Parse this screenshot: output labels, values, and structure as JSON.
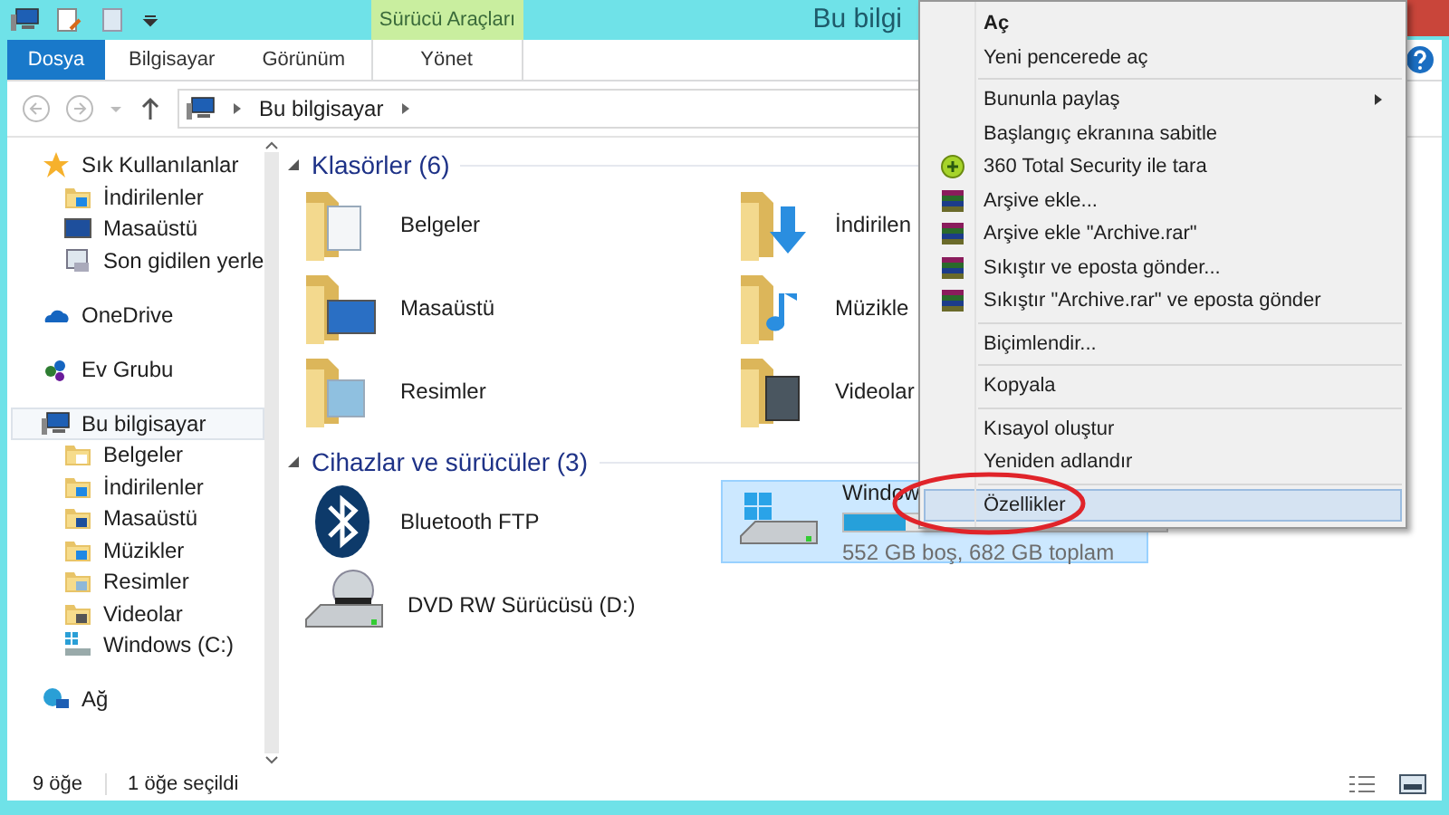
{
  "title_bar": {
    "title": "Bu bilgi",
    "context_tab": "Sürücü Araçları"
  },
  "ribbon_tabs": [
    {
      "label": "Dosya",
      "kind": "file"
    },
    {
      "label": "Bilgisayar",
      "kind": "tab"
    },
    {
      "label": "Görünüm",
      "kind": "tab"
    },
    {
      "label": "Yönet",
      "kind": "context"
    }
  ],
  "address_bar": {
    "path": [
      "Bu bilgisayar"
    ]
  },
  "navigation": [
    {
      "label": "Sık Kullanılanlar",
      "selected": false,
      "children": [
        {
          "label": "İndirilenler"
        },
        {
          "label": "Masaüstü"
        },
        {
          "label": "Son gidilen yerle"
        }
      ]
    },
    {
      "label": "OneDrive",
      "selected": false
    },
    {
      "label": "Ev Grubu",
      "selected": false
    },
    {
      "label": "Bu bilgisayar",
      "selected": true,
      "children": [
        {
          "label": "Belgeler"
        },
        {
          "label": "İndirilenler"
        },
        {
          "label": "Masaüstü"
        },
        {
          "label": "Müzikler"
        },
        {
          "label": "Resimler"
        },
        {
          "label": "Videolar"
        },
        {
          "label": "Windows (C:)"
        }
      ]
    },
    {
      "label": "Ağ",
      "selected": false
    }
  ],
  "sections": [
    {
      "title": "Klasörler (6)",
      "expanded": true,
      "items": [
        {
          "kind": "folder",
          "label": "Belgeler",
          "selected": false
        },
        {
          "kind": "folder",
          "label": "İndirilen",
          "selected": false
        },
        {
          "kind": "folder",
          "label": "Masaüstü",
          "selected": false
        },
        {
          "kind": "folder",
          "label": "Müzikle",
          "selected": false
        },
        {
          "kind": "folder",
          "label": "Resimler",
          "selected": false
        },
        {
          "kind": "folder",
          "label": "Videolar",
          "selected": false
        }
      ]
    },
    {
      "title": "Cihazlar ve sürücüler (3)",
      "expanded": true,
      "items": [
        {
          "kind": "device",
          "label": "Bluetooth FTP",
          "selected": false
        },
        {
          "kind": "drive",
          "label": "Window",
          "selected": true,
          "level": 0.19,
          "detail": "552 GB boş, 682 GB toplam"
        },
        {
          "kind": "device",
          "label": "DVD RW Sürücüsü (D:)",
          "selected": false
        }
      ]
    }
  ],
  "context_menu": {
    "groups": [
      [
        {
          "label": "Aç",
          "default": true,
          "submenu": false,
          "selected": false
        },
        {
          "label": "Yeni pencerede aç",
          "default": false,
          "submenu": false,
          "selected": false
        }
      ],
      [
        {
          "label": "Bununla paylaş",
          "default": false,
          "submenu": true,
          "selected": false
        },
        {
          "label": "Başlangıç ekranına sabitle",
          "default": false,
          "submenu": false,
          "selected": false
        },
        {
          "label": "360 Total Security ile tara",
          "default": false,
          "submenu": false,
          "selected": false
        },
        {
          "label": "Arşive ekle...",
          "default": false,
          "submenu": false,
          "selected": false
        },
        {
          "label": "Arşive ekle \"Archive.rar\"",
          "default": false,
          "submenu": false,
          "selected": false
        },
        {
          "label": "Sıkıştır ve eposta gönder...",
          "default": false,
          "submenu": false,
          "selected": false
        },
        {
          "label": "Sıkıştır \"Archive.rar\" ve eposta gönder",
          "default": false,
          "submenu": false,
          "selected": false
        }
      ],
      [
        {
          "label": "Biçimlendir...",
          "default": false,
          "submenu": false,
          "selected": false
        }
      ],
      [
        {
          "label": "Kopyala",
          "default": false,
          "submenu": false,
          "selected": false
        }
      ],
      [
        {
          "label": "Kısayol oluştur",
          "default": false,
          "submenu": false,
          "selected": false
        },
        {
          "label": "Yeniden adlandır",
          "default": false,
          "submenu": false,
          "selected": false
        }
      ],
      [
        {
          "label": "Özellikler",
          "default": false,
          "submenu": false,
          "selected": true
        }
      ]
    ]
  },
  "status_bar": {
    "count": "9 öğe",
    "selection": "1 öğe seçildi"
  }
}
